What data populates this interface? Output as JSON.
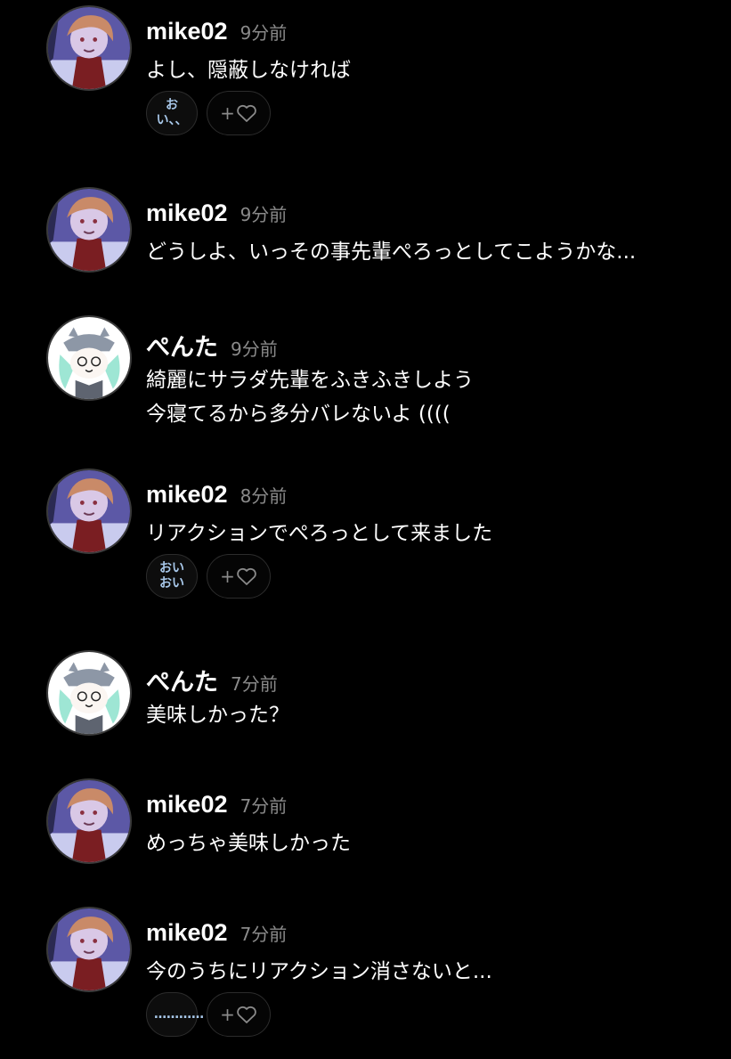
{
  "messages": [
    {
      "username": "mike02",
      "time": "9分前",
      "lines": [
        "よし、隠蔽しなければ"
      ],
      "avatar": "mike",
      "reaction": "おい、、",
      "reaction_style": "blue"
    },
    {
      "username": "mike02",
      "time": "9分前",
      "lines": [
        "どうしよ、いっその事先輩ぺろっとしてこようかな..."
      ],
      "avatar": "mike"
    },
    {
      "username": "ぺんた",
      "time": "9分前",
      "lines": [
        "綺麗にサラダ先輩をふきふきしよう",
        "今寝てるから多分バレないよ (((("
      ],
      "avatar": "penta"
    },
    {
      "username": "mike02",
      "time": "8分前",
      "lines": [
        "リアクションでぺろっとして来ました"
      ],
      "avatar": "mike",
      "reaction": "おいおい",
      "reaction_style": "blue"
    },
    {
      "username": "ぺんた",
      "time": "7分前",
      "lines": [
        "美味しかった？"
      ],
      "avatar": "penta"
    },
    {
      "username": "mike02",
      "time": "7分前",
      "lines": [
        "めっちゃ美味しかった"
      ],
      "avatar": "mike"
    },
    {
      "username": "mike02",
      "time": "7分前",
      "lines": [
        "今のうちにリアクション消さないと..."
      ],
      "avatar": "mike",
      "reaction": "…………",
      "reaction_style": "blue"
    }
  ],
  "add_reaction": {
    "plus": "+",
    "icon": "heart-outline-icon"
  },
  "colors": {
    "background": "#000000",
    "username": "#ffffff",
    "timestamp": "#8a8a8a",
    "reaction_text": "#a8c8ea",
    "chip_border": "#2c2c2c"
  }
}
